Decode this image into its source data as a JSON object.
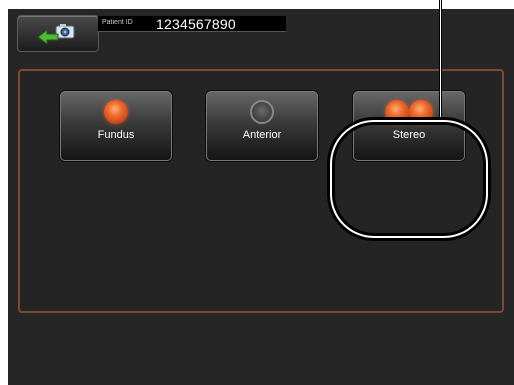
{
  "header": {
    "back_button_icon": "back-camera-icon",
    "patient_id_label": "Patient ID",
    "patient_id_value": "1234567890"
  },
  "modes": [
    {
      "label": "Fundus",
      "lamps": 1,
      "active": true
    },
    {
      "label": "Anterior",
      "lamps": 1,
      "active": false
    },
    {
      "label": "Stereo",
      "lamps": 2,
      "active": true
    }
  ],
  "colors": {
    "screen_background": "#262626",
    "panel_border": "#7a4a32",
    "lamp_on": "#f06a2a",
    "lamp_off": "#5a5a5a"
  }
}
